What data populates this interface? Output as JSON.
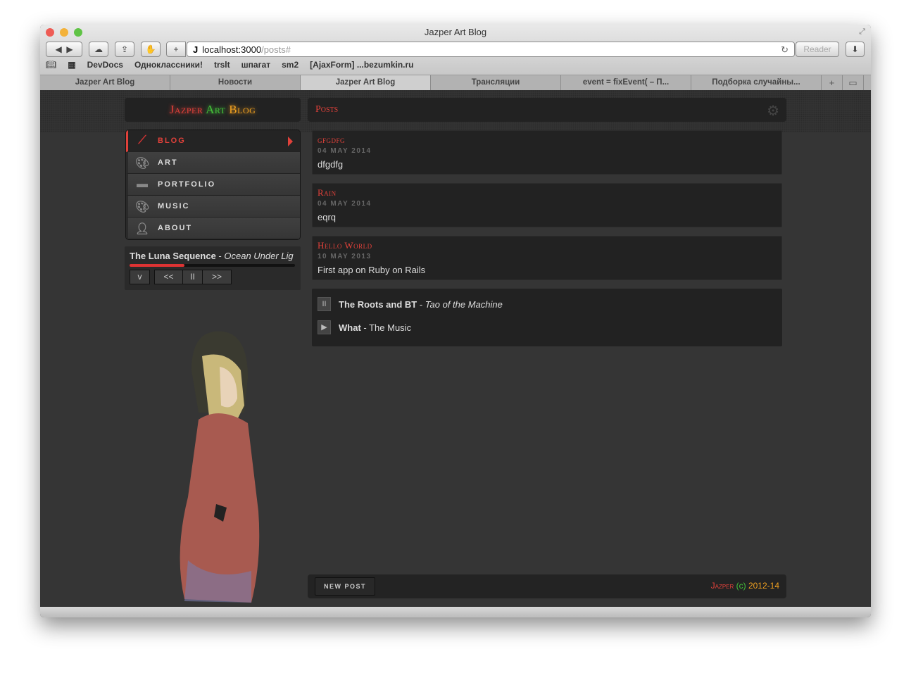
{
  "browser": {
    "title": "Jazper Art Blog",
    "url_host": "localhost:3000",
    "url_path": "/posts#",
    "reader": "Reader",
    "bookmarks": [
      "DevDocs",
      "Одноклассники!",
      "trslt",
      "шпагат",
      "sm2",
      "[AjaxForm] ...bezumkin.ru"
    ],
    "tabs": [
      "Jazper Art Blog",
      "Новости",
      "Jazper Art Blog",
      "Трансляции",
      "event = fixEvent( – П...",
      "Подборка случайны..."
    ],
    "active_tab": 2
  },
  "logo": {
    "part1": "Jazper ",
    "part2": "Art ",
    "part3": "Blog",
    "colors": [
      "#e0413a",
      "#45c43a",
      "#f0a020"
    ]
  },
  "nav": [
    {
      "label": "BLOG",
      "icon": "brush-icon"
    },
    {
      "label": "ART",
      "icon": "palette-icon"
    },
    {
      "label": "PORTFOLIO",
      "icon": "briefcase-icon"
    },
    {
      "label": "MUSIC",
      "icon": "palette-icon"
    },
    {
      "label": "ABOUT",
      "icon": "user-icon"
    }
  ],
  "player": {
    "artist": "The Luna Sequence",
    "sep": " - ",
    "track": "Ocean Under Lig",
    "progress": 0.33,
    "btn_toggle": "v",
    "btn_prev": "<<",
    "btn_pause": "II",
    "btn_next": ">>"
  },
  "main": {
    "title": "Posts",
    "posts": [
      {
        "title": "gfgdfg",
        "date": "04 MAY 2014",
        "body": "dfgdfg"
      },
      {
        "title": "Rain",
        "date": "04 MAY 2014",
        "body": "eqrq"
      },
      {
        "title": "Hello World",
        "date": "10 MAY 2013",
        "body": "First app on Ruby on Rails"
      }
    ],
    "playlist": [
      {
        "artist": "The Roots and BT",
        "sep": " - ",
        "track": "Tao of the Machine",
        "state": "II"
      },
      {
        "artist": "What",
        "sep": " - ",
        "track": "The Music",
        "state": "▶"
      }
    ]
  },
  "footer": {
    "new_post": "NEW POST",
    "copy1": "Jazper",
    "copy2": " (c) ",
    "copy3": "2012-14"
  }
}
